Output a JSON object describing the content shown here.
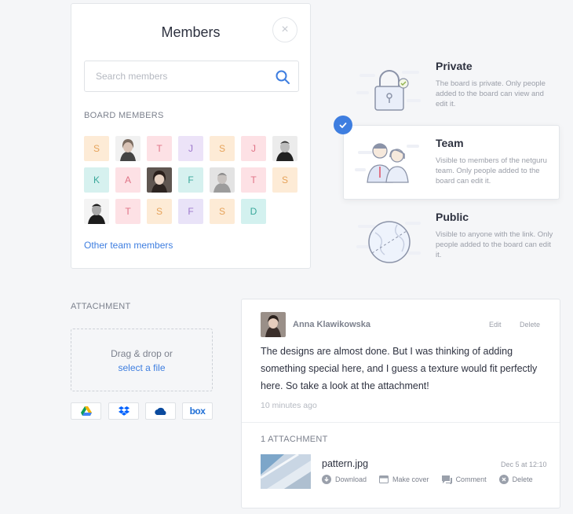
{
  "members": {
    "title": "Members",
    "close": "×",
    "search_placeholder": "Search members",
    "section_label": "BOARD MEMBERS",
    "other_link": "Other team members",
    "tiles": [
      {
        "letter": "S",
        "color": "S"
      },
      {
        "photo": "woman-blonde"
      },
      {
        "letter": "T",
        "color": "T"
      },
      {
        "letter": "J",
        "color": "J"
      },
      {
        "letter": "S",
        "color": "S"
      },
      {
        "letter": "J",
        "color": "T"
      },
      {
        "photo": "man-bw"
      },
      {
        "letter": "K",
        "color": "K"
      },
      {
        "letter": "A",
        "color": "A"
      },
      {
        "photo": "woman-dark"
      },
      {
        "letter": "F",
        "color": "F2"
      },
      {
        "photo": "man-grey"
      },
      {
        "letter": "T",
        "color": "T"
      },
      {
        "letter": "S",
        "color": "S"
      },
      {
        "photo": "man-bw2"
      },
      {
        "letter": "T",
        "color": "T"
      },
      {
        "letter": "S",
        "color": "S"
      },
      {
        "letter": "F",
        "color": "F"
      },
      {
        "letter": "S",
        "color": "S"
      },
      {
        "letter": "D",
        "color": "D"
      }
    ]
  },
  "visibility": {
    "private": {
      "title": "Private",
      "desc": "The board is private. Only people added to the board can view and edit it."
    },
    "team": {
      "title": "Team",
      "desc": "Visible to members of the netguru team. Only people added to the board can edit it."
    },
    "public": {
      "title": "Public",
      "desc": "Visible to anyone with the link. Only people added to the board can edit it."
    }
  },
  "attachment": {
    "label": "ATTACHMENT",
    "drop_text": "Drag & drop or",
    "select_link": "select a file",
    "services": [
      "google-drive-icon",
      "dropbox-icon",
      "onedrive-icon",
      "box-icon"
    ],
    "box_label": "box"
  },
  "comment": {
    "author": "Anna Klawikowska",
    "edit": "Edit",
    "delete": "Delete",
    "body": "The designs are almost done. But I was thinking of adding something special here, and I guess a texture would fit perfectly here. So take a look at the attachment!",
    "time": "10 minutes ago",
    "attachment_count": "1 ATTACHMENT",
    "file": {
      "name": "pattern.jpg",
      "date": "Dec 5 at 12:10",
      "actions": [
        "Download",
        "Make cover",
        "Comment",
        "Delete"
      ]
    }
  },
  "colors": {
    "accent": "#3e7ee0",
    "text": "#2e3240",
    "muted": "#9a9ea8"
  }
}
